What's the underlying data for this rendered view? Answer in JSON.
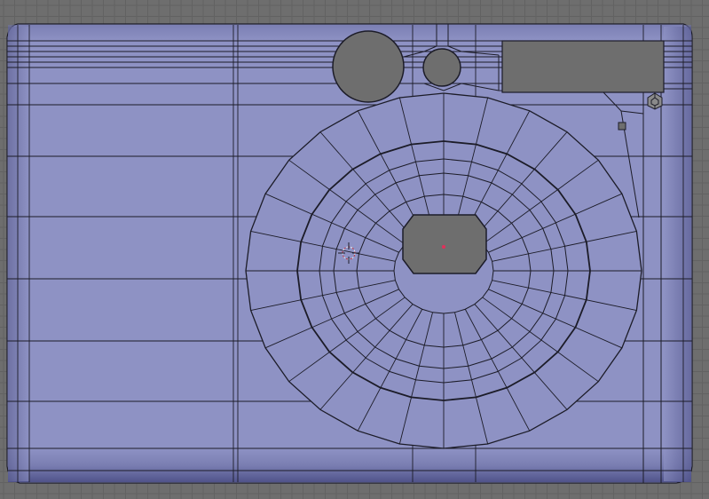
{
  "viewport": {
    "view": "front-orthographic",
    "mode": "edit-mode-wireframe-over-solid",
    "object": "camera-body-mesh",
    "grid_visible": true
  },
  "colors": {
    "background": "#6e6e6e",
    "grid_line": "#626262",
    "mesh_face": "#8e92c4",
    "mesh_face_light": "#a0a4d4",
    "mesh_shadow": "#5a5d8f",
    "mesh_dark": "#3f4170",
    "wire": "#1c1c28",
    "hole_fill": "#6e6e6e",
    "center_point": "#e0305a"
  },
  "icons": {
    "object_center": "red-dot",
    "3d_cursor": "crosshair-ring",
    "lamp_gizmo": "hex-wire",
    "selected_vertex": "small-square"
  }
}
